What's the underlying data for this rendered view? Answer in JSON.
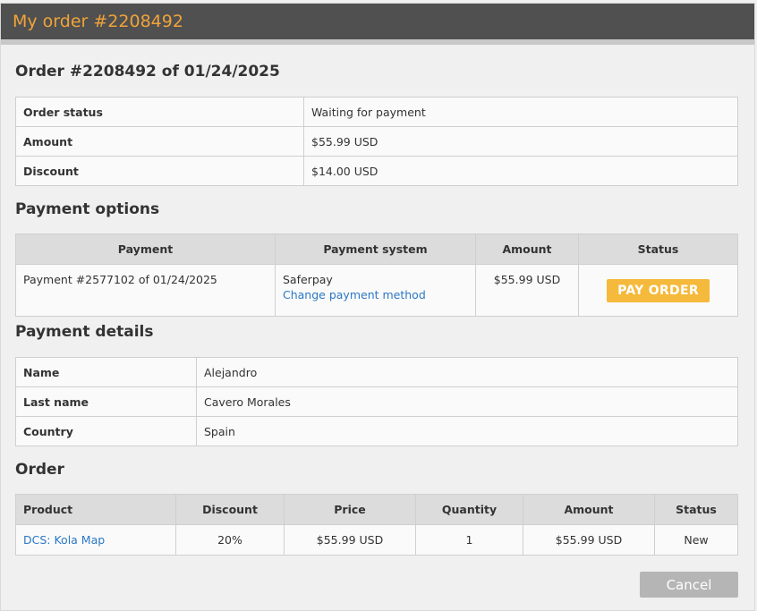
{
  "window": {
    "title": "My order #2208492"
  },
  "order_header": "Order #2208492 of 01/24/2025",
  "summary": [
    {
      "label": "Order status",
      "value": "Waiting for payment"
    },
    {
      "label": "Amount",
      "value": "$55.99 USD"
    },
    {
      "label": "Discount",
      "value": "$14.00 USD"
    }
  ],
  "payment_options": {
    "heading": "Payment options",
    "columns": [
      "Payment",
      "Payment system",
      "Amount",
      "Status"
    ],
    "row": {
      "payment": "Payment #2577102 of 01/24/2025",
      "system": "Saferpay",
      "change_link": "Change payment method",
      "amount": "$55.99 USD",
      "button": "PAY ORDER"
    }
  },
  "payment_details": {
    "heading": "Payment details",
    "rows": [
      {
        "label": "Name",
        "value": "Alejandro"
      },
      {
        "label": "Last name",
        "value": "Cavero Morales"
      },
      {
        "label": "Country",
        "value": "Spain"
      }
    ]
  },
  "order": {
    "heading": "Order",
    "columns": [
      "Product",
      "Discount",
      "Price",
      "Quantity",
      "Amount",
      "Status"
    ],
    "rows": [
      {
        "product": "DCS: Kola Map",
        "discount": "20%",
        "price": "$55.99 USD",
        "quantity": "1",
        "amount": "$55.99 USD",
        "status": "New"
      }
    ]
  },
  "cancel_label": "Cancel",
  "colors": {
    "accent": "#f0a33a",
    "button": "#f5b93b",
    "link": "#2b78c5",
    "titlebar": "#505050"
  }
}
